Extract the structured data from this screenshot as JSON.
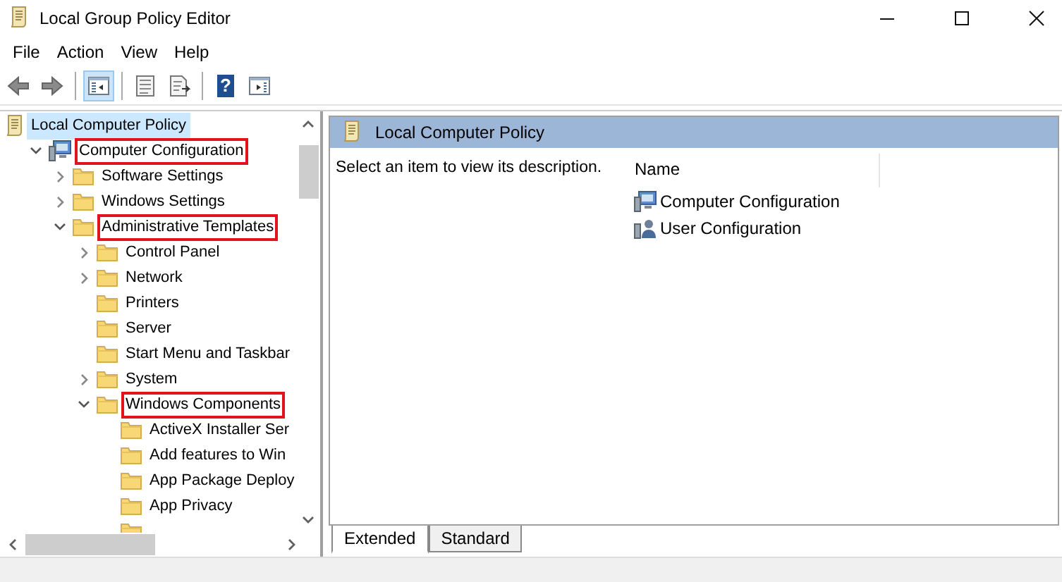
{
  "window": {
    "title": "Local Group Policy Editor"
  },
  "menu": [
    "File",
    "Action",
    "View",
    "Help"
  ],
  "toolbar": [
    {
      "kind": "back",
      "pressed": false
    },
    {
      "kind": "forward",
      "pressed": false
    },
    {
      "kind": "sep"
    },
    {
      "kind": "tree",
      "pressed": true
    },
    {
      "kind": "sep"
    },
    {
      "kind": "properties",
      "pressed": false
    },
    {
      "kind": "export",
      "pressed": false
    },
    {
      "kind": "sep"
    },
    {
      "kind": "help",
      "pressed": false,
      "glyph": "?"
    },
    {
      "kind": "actionpane",
      "pressed": false
    }
  ],
  "tree": [
    {
      "label": "Local Computer Policy",
      "selected": true,
      "highlighted": false,
      "children": [
        {
          "label": "Computer Configuration",
          "expanded": true,
          "selected": false,
          "highlighted": true,
          "children": [
            {
              "label": "Software Settings",
              "expanded": false,
              "selected": false,
              "highlighted": false
            },
            {
              "label": "Windows Settings",
              "expanded": false,
              "selected": false,
              "highlighted": false
            },
            {
              "label": "Administrative Templates",
              "expanded": true,
              "selected": false,
              "highlighted": true,
              "children": [
                {
                  "label": "Control Panel",
                  "expanded": false,
                  "selected": false,
                  "highlighted": false
                },
                {
                  "label": "Network",
                  "expanded": false,
                  "selected": false,
                  "highlighted": false
                },
                {
                  "label": "Printers",
                  "selected": false,
                  "highlighted": false
                },
                {
                  "label": "Server",
                  "selected": false,
                  "highlighted": false
                },
                {
                  "label": "Start Menu and Taskbar",
                  "selected": false,
                  "highlighted": false
                },
                {
                  "label": "System",
                  "expanded": false,
                  "selected": false,
                  "highlighted": false
                },
                {
                  "label": "Windows Components",
                  "expanded": true,
                  "selected": false,
                  "highlighted": true,
                  "children": [
                    {
                      "label": "ActiveX Installer Ser",
                      "selected": false,
                      "highlighted": false
                    },
                    {
                      "label": "Add features to Win",
                      "selected": false,
                      "highlighted": false
                    },
                    {
                      "label": "App Package Deploy",
                      "selected": false,
                      "highlighted": false
                    },
                    {
                      "label": "App Privacy",
                      "selected": false,
                      "highlighted": false
                    }
                  ]
                }
              ]
            }
          ]
        }
      ]
    }
  ],
  "details": {
    "header": "Local Computer Policy",
    "description": "Select an item to view its description.",
    "column": "Name",
    "items": [
      {
        "label": "Computer Configuration"
      },
      {
        "label": "User Configuration"
      }
    ]
  },
  "tabs": [
    {
      "label": "Extended",
      "selected": true
    },
    {
      "label": "Standard",
      "selected": false
    }
  ]
}
